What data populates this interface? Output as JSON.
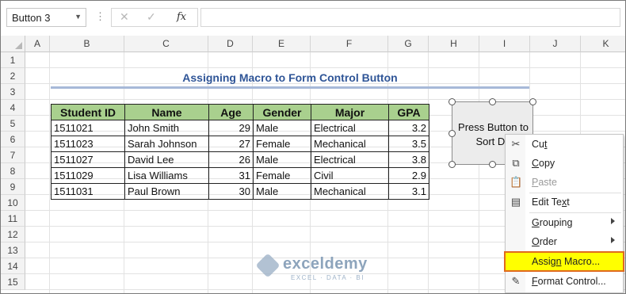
{
  "formula_bar": {
    "name_box": "Button 3",
    "more_label": "⋮",
    "cancel_label": "✕",
    "enter_label": "✓",
    "fx_label": "fx",
    "formula": ""
  },
  "columns": [
    "A",
    "B",
    "C",
    "D",
    "E",
    "F",
    "G",
    "H",
    "I",
    "J",
    "K"
  ],
  "rows": [
    "1",
    "2",
    "3",
    "4",
    "5",
    "6",
    "7",
    "8",
    "9",
    "10",
    "11",
    "12",
    "13",
    "14",
    "15"
  ],
  "sheet": {
    "title": "Assigning Macro to Form Control Button",
    "headers": [
      "Student ID",
      "Name",
      "Age",
      "Gender",
      "Major",
      "GPA"
    ],
    "records": [
      {
        "id": "1511021",
        "name": "John Smith",
        "age": "29",
        "gender": "Male",
        "major": "Electrical",
        "gpa": "3.2"
      },
      {
        "id": "1511023",
        "name": "Sarah Johnson",
        "age": "27",
        "gender": "Female",
        "major": "Mechanical",
        "gpa": "3.5"
      },
      {
        "id": "1511027",
        "name": "David Lee",
        "age": "26",
        "gender": "Male",
        "major": "Electrical",
        "gpa": "3.8"
      },
      {
        "id": "1511029",
        "name": "Lisa Williams",
        "age": "31",
        "gender": "Female",
        "major": "Civil",
        "gpa": "2.9"
      },
      {
        "id": "1511031",
        "name": "Paul Brown",
        "age": "30",
        "gender": "Male",
        "major": "Mechanical",
        "gpa": "3.1"
      }
    ]
  },
  "form_button": {
    "label_line1": "Press Button to",
    "label_line2": "Sort Da"
  },
  "context_menu": {
    "cut": {
      "pre": "Cu",
      "acc": "t",
      "post": ""
    },
    "copy": {
      "pre": "",
      "acc": "C",
      "post": "opy"
    },
    "paste": {
      "pre": "",
      "acc": "P",
      "post": "aste"
    },
    "edit_text": {
      "pre": "Edit Te",
      "acc": "x",
      "post": "t"
    },
    "grouping": {
      "pre": "",
      "acc": "G",
      "post": "rouping"
    },
    "order": {
      "pre": "",
      "acc": "O",
      "post": "rder"
    },
    "assign_macro": {
      "pre": "Assig",
      "acc": "n",
      "post": " Macro..."
    },
    "format_control": {
      "pre": "",
      "acc": "F",
      "post": "ormat Control..."
    }
  },
  "watermark": {
    "name": "exceldemy",
    "tagline": "EXCEL · DATA · BI"
  },
  "colors": {
    "header_fill": "#a9d08e",
    "title": "#2f5597",
    "highlight": "#ffff00",
    "highlight_border": "#e06a1f"
  }
}
